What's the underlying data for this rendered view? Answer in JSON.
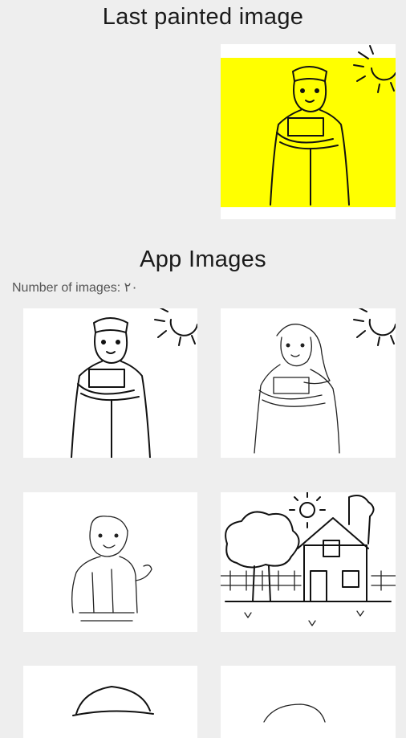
{
  "header": {
    "last_painted_title": "Last painted image"
  },
  "last_painted": {
    "background_color": "#ffff00",
    "image": "boy-with-book-colored"
  },
  "gallery": {
    "title": "App Images",
    "count_label": "Number of images: ٢٠",
    "items": [
      {
        "image": "boy-with-book"
      },
      {
        "image": "girl-in-hijab-with-book"
      },
      {
        "image": "boy-waving"
      },
      {
        "image": "house-with-tree"
      },
      {
        "image": "boy-with-cap"
      },
      {
        "image": "head-outline"
      }
    ]
  },
  "colors": {
    "background": "#eeeeee",
    "card": "#ffffff",
    "accent_fill": "#ffff00"
  }
}
